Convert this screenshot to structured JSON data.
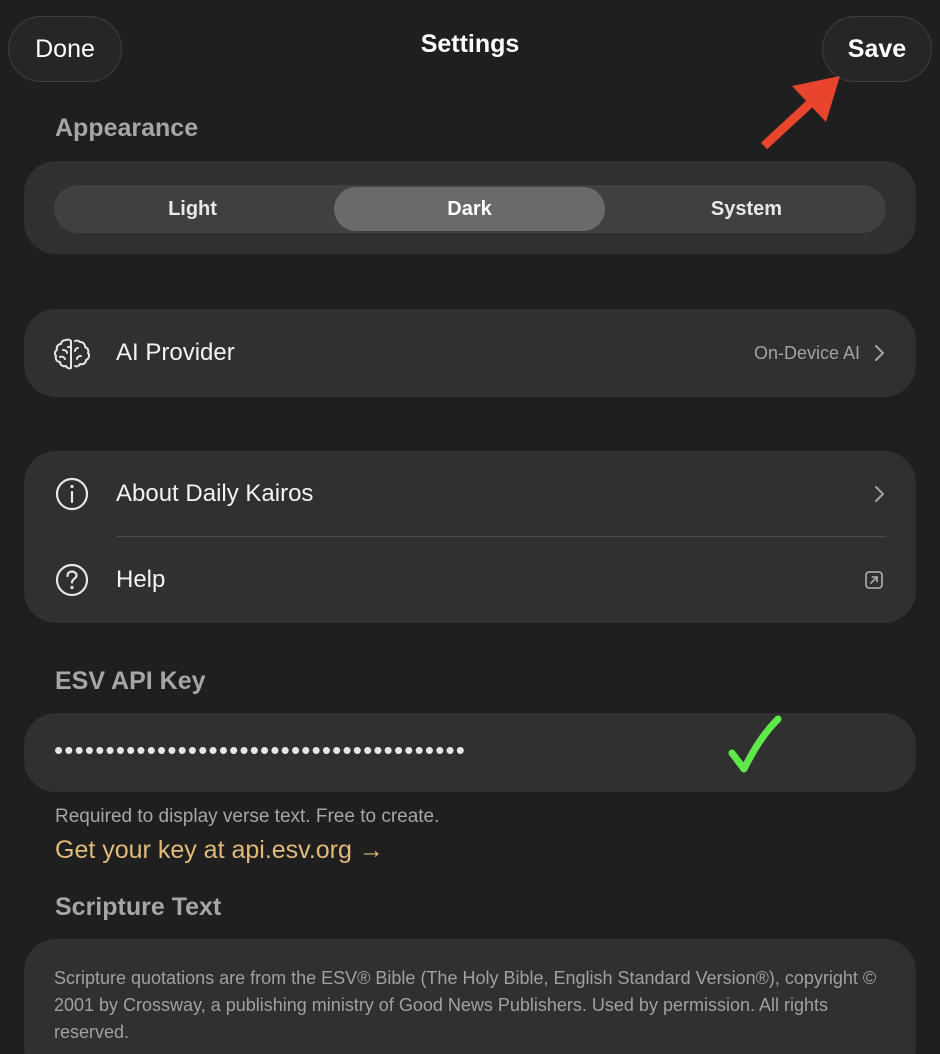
{
  "header": {
    "done_label": "Done",
    "title": "Settings",
    "save_label": "Save"
  },
  "appearance": {
    "label": "Appearance",
    "options": [
      "Light",
      "Dark",
      "System"
    ],
    "selected": "Dark"
  },
  "ai_provider": {
    "label": "AI Provider",
    "value": "On-Device AI",
    "icon": "brain-icon"
  },
  "info": {
    "about_label": "About Daily Kairos",
    "help_label": "Help"
  },
  "esv": {
    "label": "ESV API Key",
    "masked_value": "••••••••••••••••••••••••••••••••••••••••",
    "helper_text": "Required to display verse text. Free to create.",
    "link_text": "Get your key at api.esv.org →"
  },
  "scripture": {
    "label": "Scripture Text",
    "body": "Scripture quotations are from the ESV® Bible (The Holy Bible, English Standard Version®), copyright © 2001 by Crossway, a publishing ministry of Good News Publishers. Used by permission. All rights reserved."
  },
  "colors": {
    "background": "#1f1f1f",
    "card": "#303030",
    "accent_link": "#e1b97a",
    "annotation_arrow": "#e8452c",
    "annotation_check": "#5ee84a"
  }
}
